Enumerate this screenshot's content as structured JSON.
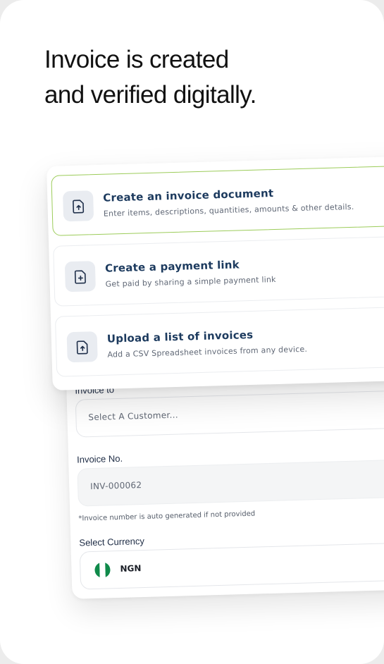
{
  "headline": {
    "line1": "Invoice is created",
    "line2": "and verified digitally."
  },
  "options": [
    {
      "title": "Create an invoice document",
      "subtitle": "Enter items, descriptions, quantities, amounts & other details.",
      "icon": "file-upload-icon",
      "selected": true
    },
    {
      "title": "Create a payment link",
      "subtitle": "Get paid by sharing a simple payment link",
      "icon": "file-plus-icon",
      "selected": false
    },
    {
      "title": "Upload a list of invoices",
      "subtitle": "Add a CSV Spreadsheet invoices from any device.",
      "icon": "file-upload-icon",
      "selected": false
    }
  ],
  "form": {
    "invoice_to_label": "Invoice to",
    "customer_placeholder": "Select A Customer...",
    "invoice_no_label": "Invoice No.",
    "invoice_no_value": "INV-000062",
    "invoice_no_note": "*Invoice number is auto generated if not provided",
    "currency_label": "Select Currency",
    "currency_value": "NGN",
    "currency_flag": "nigeria-flag-icon"
  },
  "colors": {
    "selected_border": "#9ccc5a",
    "title_navy": "#1c3a5e",
    "flag_green": "#0f8a4a"
  }
}
